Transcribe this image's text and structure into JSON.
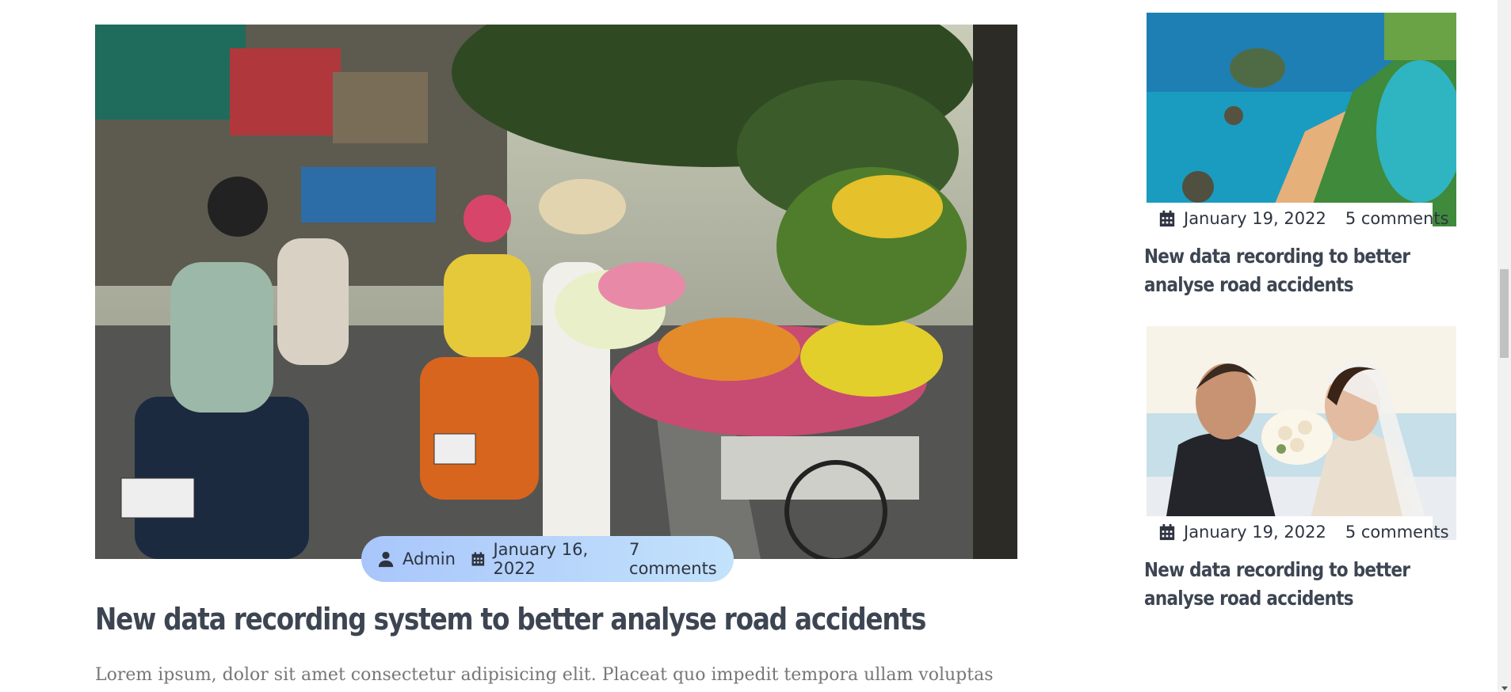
{
  "main_post": {
    "author": "Admin",
    "date": "January 16, 2022",
    "comments": "7 comments",
    "title": "New data recording system to better analyse road accidents",
    "excerpt": "Lorem ipsum, dolor sit amet consectetur adipisicing elit. Placeat quo impedit tempora ullam voluptas"
  },
  "sidebar": {
    "posts": [
      {
        "date": "January 19, 2022",
        "comments": "5 comments",
        "title": "New data recording to better analyse road accidents"
      },
      {
        "date": "January 19, 2022",
        "comments": "5 comments",
        "title": "New data recording to better analyse road accidents"
      }
    ]
  },
  "icons": {
    "author": "user-icon",
    "date": "calendar-icon"
  },
  "colors": {
    "pill_start": "#a9c6fb",
    "pill_end": "#c3e2fb",
    "title": "#3d4552",
    "excerpt": "#777777"
  }
}
